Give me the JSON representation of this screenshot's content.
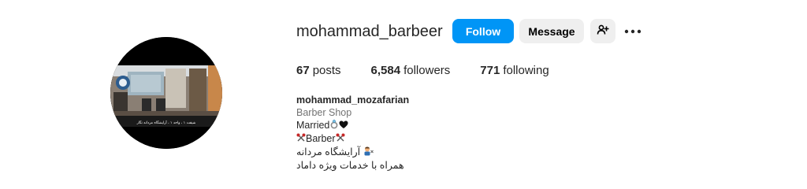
{
  "profile": {
    "username": "mohammad_barbeer",
    "full_name": "mohammad_mozafarian",
    "category": "Barber Shop",
    "avatar_caption": "شیفت ۱ ، واحد ۱ ، آرایشگاه مردانه نگار"
  },
  "actions": {
    "follow_label": "Follow",
    "message_label": "Message",
    "add_user_icon": "person-add-icon",
    "more_icon": "more-options-icon"
  },
  "stats": {
    "posts_count": "67",
    "posts_label": "posts",
    "followers_count": "6,584",
    "followers_label": "followers",
    "following_count": "771",
    "following_label": "following"
  },
  "bio": {
    "line1_text": "Married",
    "line1_icons": [
      "ring-icon",
      "black-heart-icon"
    ],
    "line2_text": "Barber",
    "line2_icons": [
      "scissors-icon",
      "scissors-icon"
    ],
    "line3_text": "آرایشگاه مردانه",
    "line3_icon": "haircut-icon",
    "line4_text": "همراه با خدمات ویژه داماد"
  },
  "colors": {
    "follow_button": "#0095f6",
    "secondary_button": "#efefef",
    "text": "#262626",
    "muted": "#737373"
  }
}
